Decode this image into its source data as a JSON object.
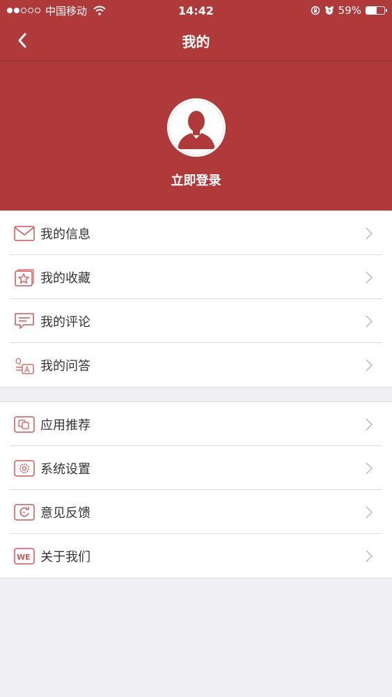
{
  "status_bar": {
    "carrier": "中国移动",
    "time": "14:42",
    "battery": "59%",
    "battery_level": 0.59
  },
  "nav": {
    "title": "我的",
    "back_icon": "chevron-left-icon"
  },
  "profile": {
    "avatar_icon": "user-silhouette-icon",
    "login_label": "立即登录"
  },
  "colors": {
    "brand": "#b03a3a",
    "icon_accent": "#d15656"
  },
  "menu_groups": [
    {
      "items": [
        {
          "label": "我的信息",
          "icon": "envelope-icon"
        },
        {
          "label": "我的收藏",
          "icon": "star-icon"
        },
        {
          "label": "我的评论",
          "icon": "comment-icon"
        },
        {
          "label": "我的问答",
          "icon": "qa-icon"
        }
      ]
    },
    {
      "items": [
        {
          "label": "应用推荐",
          "icon": "apps-icon"
        },
        {
          "label": "系统设置",
          "icon": "gear-icon"
        },
        {
          "label": "意见反馈",
          "icon": "feedback-icon"
        },
        {
          "label": "关于我们",
          "icon": "we-icon"
        }
      ]
    }
  ]
}
